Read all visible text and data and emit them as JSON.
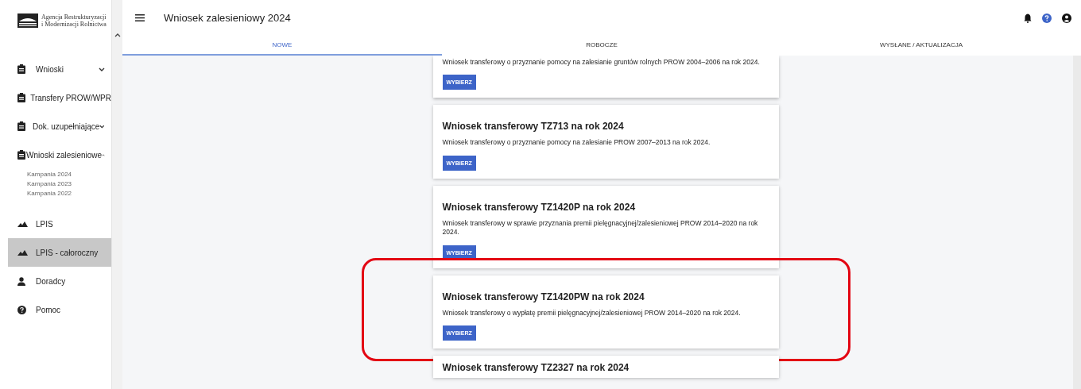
{
  "logo": {
    "lines": [
      "Agencja Restrukturyzacji",
      "i Modernizacji Rolnictwa"
    ]
  },
  "sidebar": {
    "items": [
      {
        "label": "Wnioski",
        "kind": "clipboard",
        "expanded": false,
        "selected": false
      },
      {
        "label": "Transfery PROW/WPR",
        "kind": "clipboard",
        "selected": false
      },
      {
        "label": "Dok. uzupełniające",
        "kind": "clipboard",
        "expanded": false,
        "selected": false
      },
      {
        "label": "Wnioski zalesieniowe",
        "kind": "clipboard",
        "expanded": true,
        "selected": false,
        "children": [
          {
            "label": "Kampania 2024"
          },
          {
            "label": "Kampania 2023"
          },
          {
            "label": "Kampania 2022"
          }
        ]
      },
      {
        "label": "LPIS",
        "kind": "terrain",
        "selected": false
      },
      {
        "label": "LPIS - całoroczny",
        "kind": "terrain",
        "selected": true
      },
      {
        "label": "Doradcy",
        "kind": "person",
        "selected": false
      },
      {
        "label": "Pomoc",
        "kind": "help",
        "selected": false
      }
    ]
  },
  "header": {
    "title": "Wniosek zalesieniowy 2024"
  },
  "tabs": [
    {
      "label": "NOWE",
      "selected": true
    },
    {
      "label": "ROBOCZE",
      "selected": false
    },
    {
      "label": "WYSŁANE / AKTUALIZACJA",
      "selected": false
    }
  ],
  "cards": [
    {
      "description": "Wniosek transferowy o przyznanie pomocy na zalesianie gruntów rolnych PROW 2004–2006 na rok 2024.",
      "button": "WYBIERZ",
      "highlighted": false
    },
    {
      "title": "Wniosek transferowy TZ713 na rok 2024",
      "description": "Wniosek transferowy o przyznanie pomocy na zalesianie PROW 2007–2013 na rok 2024.",
      "button": "WYBIERZ",
      "highlighted": false
    },
    {
      "title": "Wniosek transferowy TZ1420P na rok 2024",
      "description": "Wniosek transferowy w sprawie przyznania premii pielęgnacyjnej/zalesieniowej PROW 2014–2020 na rok 2024.",
      "button": "WYBIERZ",
      "highlighted": false
    },
    {
      "title": "Wniosek transferowy TZ1420PW na rok 2024",
      "description": "Wniosek transferowy o wypłatę premii pielęgnacyjnej/zalesieniowej PROW 2014–2020 na rok 2024.",
      "button": "WYBIERZ",
      "highlighted": true
    },
    {
      "title": "Wniosek transferowy TZ2327 na rok 2024"
    }
  ]
}
